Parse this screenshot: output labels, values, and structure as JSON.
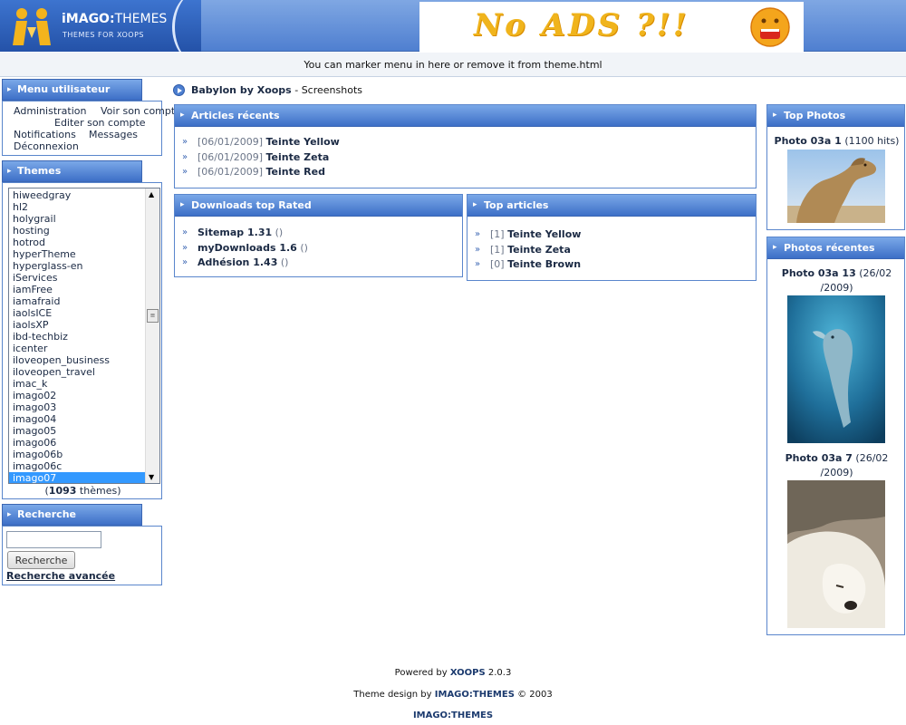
{
  "header": {
    "logo_title_bold": "iMAGO:",
    "logo_title_rest": "THEMES",
    "logo_subtitle": "THEMES FOR XOOPS",
    "ad_text": "No ADS ?!!"
  },
  "marker_text": "You can marker menu in here or remove it from theme.html",
  "user_menu": {
    "title": "Menu utilisateur",
    "items": [
      "Administration",
      "Voir son compte",
      "Editer son compte",
      "Notifications",
      "Messages",
      "Déconnexion"
    ]
  },
  "themes": {
    "title": "Themes",
    "items": [
      "hiweedgray",
      "hl2",
      "holygrail",
      "hosting",
      "hotrod",
      "hyperTheme",
      "hyperglass-en",
      "iServices",
      "iamFree",
      "iamafraid",
      "iaolsICE",
      "iaolsXP",
      "ibd-techbiz",
      "icenter",
      "iloveopen_business",
      "iloveopen_travel",
      "imac_k",
      "imago02",
      "imago03",
      "imago04",
      "imago05",
      "imago06",
      "imago06b",
      "imago06c",
      "imago07"
    ],
    "selected": "imago07",
    "count": "1093",
    "count_label": "thèmes"
  },
  "search": {
    "title": "Recherche",
    "input_value": "",
    "button_label": "Recherche",
    "advanced_label": "Recherche avancée"
  },
  "breadcrumb": {
    "site": "Babylon by Xoops",
    "separator": " - ",
    "page": "Screenshots"
  },
  "articles_recents": {
    "title": "Articles récents",
    "items": [
      {
        "date": "[06/01/2009]",
        "name": "Teinte Yellow"
      },
      {
        "date": "[06/01/2009]",
        "name": "Teinte Zeta"
      },
      {
        "date": "[06/01/2009]",
        "name": "Teinte Red"
      }
    ]
  },
  "downloads": {
    "title": "Downloads top Rated",
    "items": [
      {
        "name": "Sitemap 1.31",
        "extra": "()"
      },
      {
        "name": "myDownloads 1.6",
        "extra": "()"
      },
      {
        "name": "Adhésion 1.43",
        "extra": "()"
      }
    ]
  },
  "top_articles": {
    "title": "Top articles",
    "items": [
      {
        "rank": "[1]",
        "name": "Teinte Yellow"
      },
      {
        "rank": "[1]",
        "name": "Teinte Zeta"
      },
      {
        "rank": "[0]",
        "name": "Teinte Brown"
      }
    ]
  },
  "top_photos": {
    "title": "Top Photos",
    "photo_name": "Photo 03a 1",
    "photo_hits": "(1100 hits)",
    "photo_icon": "camel-photo"
  },
  "recent_photos": {
    "title": "Photos récentes",
    "items": [
      {
        "name": "Photo 03a 13",
        "date_line1": "(26/02",
        "date_line2": "/2009)",
        "icon": "dolphin-photo"
      },
      {
        "name": "Photo 03a 7",
        "date_line1": "(26/02",
        "date_line2": "/2009)",
        "icon": "polar-bear-photo"
      }
    ]
  },
  "footer": {
    "powered_prefix": "Powered by",
    "powered_name": "XOOPS",
    "powered_version": "2.0.3",
    "design_prefix": "Theme design by",
    "design_name": "IMAGO:THEMES",
    "design_suffix": "© 2003",
    "credit": "IMAGO:THEMES"
  },
  "colors": {
    "header_blue": "#4f7fd0",
    "block_border": "#5a86cc",
    "selected_item": "#3399ff",
    "ad_yellow": "#f0b41c"
  }
}
